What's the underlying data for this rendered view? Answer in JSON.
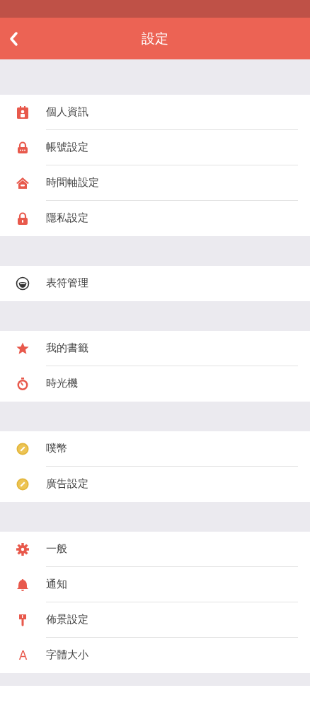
{
  "header": {
    "title": "設定"
  },
  "sections": [
    {
      "items": [
        {
          "label": "個人資訊",
          "kind": "idcard"
        },
        {
          "label": "帳號設定",
          "kind": "lockdots"
        },
        {
          "label": "時間軸設定",
          "kind": "house"
        },
        {
          "label": "隱私設定",
          "kind": "lock"
        }
      ]
    },
    {
      "items": [
        {
          "label": "表符管理",
          "kind": "emoji"
        }
      ]
    },
    {
      "items": [
        {
          "label": "我的書籤",
          "kind": "star"
        },
        {
          "label": "時光機",
          "kind": "stopwatch"
        }
      ]
    },
    {
      "items": [
        {
          "label": "噗幣",
          "kind": "coin"
        },
        {
          "label": "廣告設定",
          "kind": "coin"
        }
      ]
    },
    {
      "items": [
        {
          "label": "一般",
          "kind": "gear"
        },
        {
          "label": "通知",
          "kind": "bell"
        },
        {
          "label": "佈景設定",
          "kind": "brush"
        },
        {
          "label": "字體大小",
          "kind": "letter",
          "glyph": "A"
        }
      ]
    }
  ]
}
